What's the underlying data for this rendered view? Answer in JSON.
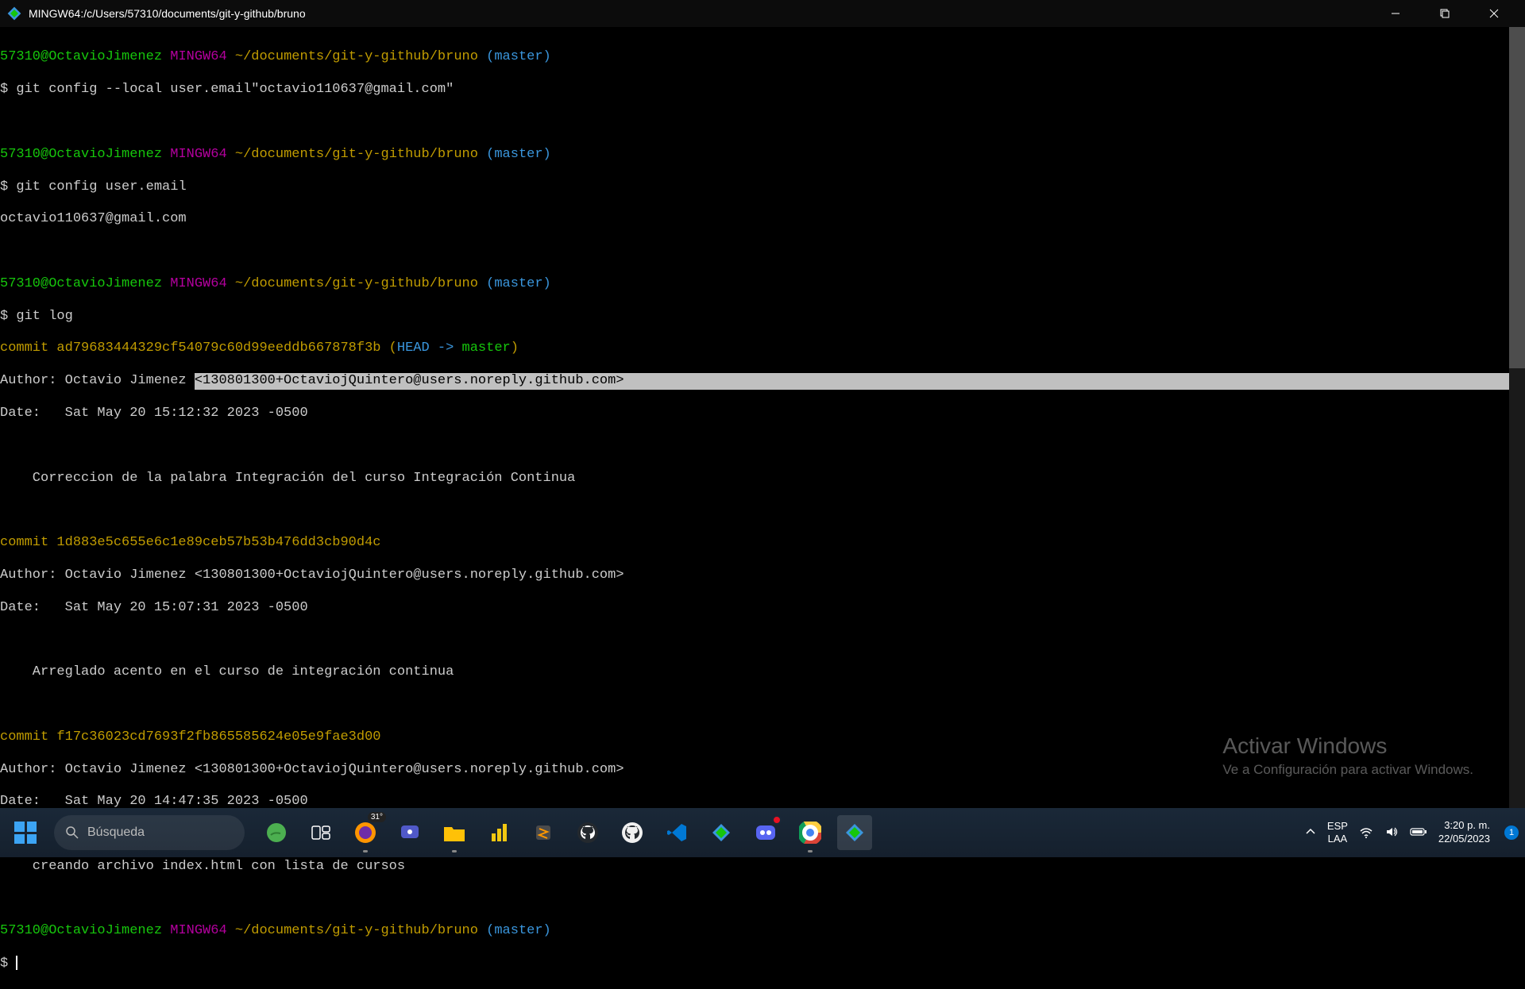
{
  "titlebar": {
    "title": "MINGW64:/c/Users/57310/documents/git-y-github/bruno"
  },
  "prompt": {
    "user": "57310@OctavioJimenez",
    "env": "MINGW64",
    "path": "~/documents/git-y-github/bruno",
    "branch": "(master)",
    "sigil": "$"
  },
  "commands": {
    "cmd1": "git config --local user.email\"octavio110637@gmail.com\"",
    "cmd2": "git config user.email",
    "cmd2_output": "octavio110637@gmail.com",
    "cmd3": "git log"
  },
  "commits": [
    {
      "sha": "commit ad79683444329cf54079c60d99eeddb667878f3b",
      "ref_open": " (",
      "ref_head": "HEAD -> ",
      "ref_branch": "master",
      "ref_close": ")",
      "author_prefix": "Author: Octavio Jimenez ",
      "author_email": "<130801300+OctaviojQuintero@users.noreply.github.com>",
      "date": "Date:   Sat May 20 15:12:32 2023 -0500",
      "msg": "    Correccion de la palabra Integración del curso Integración Continua",
      "email_highlighted": true
    },
    {
      "sha": "commit 1d883e5c655e6c1e89ceb57b53b476dd3cb90d4c",
      "author": "Author: Octavio Jimenez <130801300+OctaviojQuintero@users.noreply.github.com>",
      "date": "Date:   Sat May 20 15:07:31 2023 -0500",
      "msg": "    Arreglado acento en el curso de integración continua"
    },
    {
      "sha": "commit f17c36023cd7693f2fb865585624e05e9fae3d00",
      "author": "Author: Octavio Jimenez <130801300+OctaviojQuintero@users.noreply.github.com>",
      "date": "Date:   Sat May 20 14:47:35 2023 -0500",
      "msg": "    creando archivo index.html con lista de cursos"
    }
  ],
  "watermark": {
    "title": "Activar Windows",
    "sub": "Ve a Configuración para activar Windows."
  },
  "taskbar": {
    "search_placeholder": "Búsqueda",
    "weather_temp": "31°",
    "lang_top": "ESP",
    "lang_bottom": "LAA",
    "time": "3:20 p. m.",
    "date": "22/05/2023",
    "notif_count": "1"
  }
}
